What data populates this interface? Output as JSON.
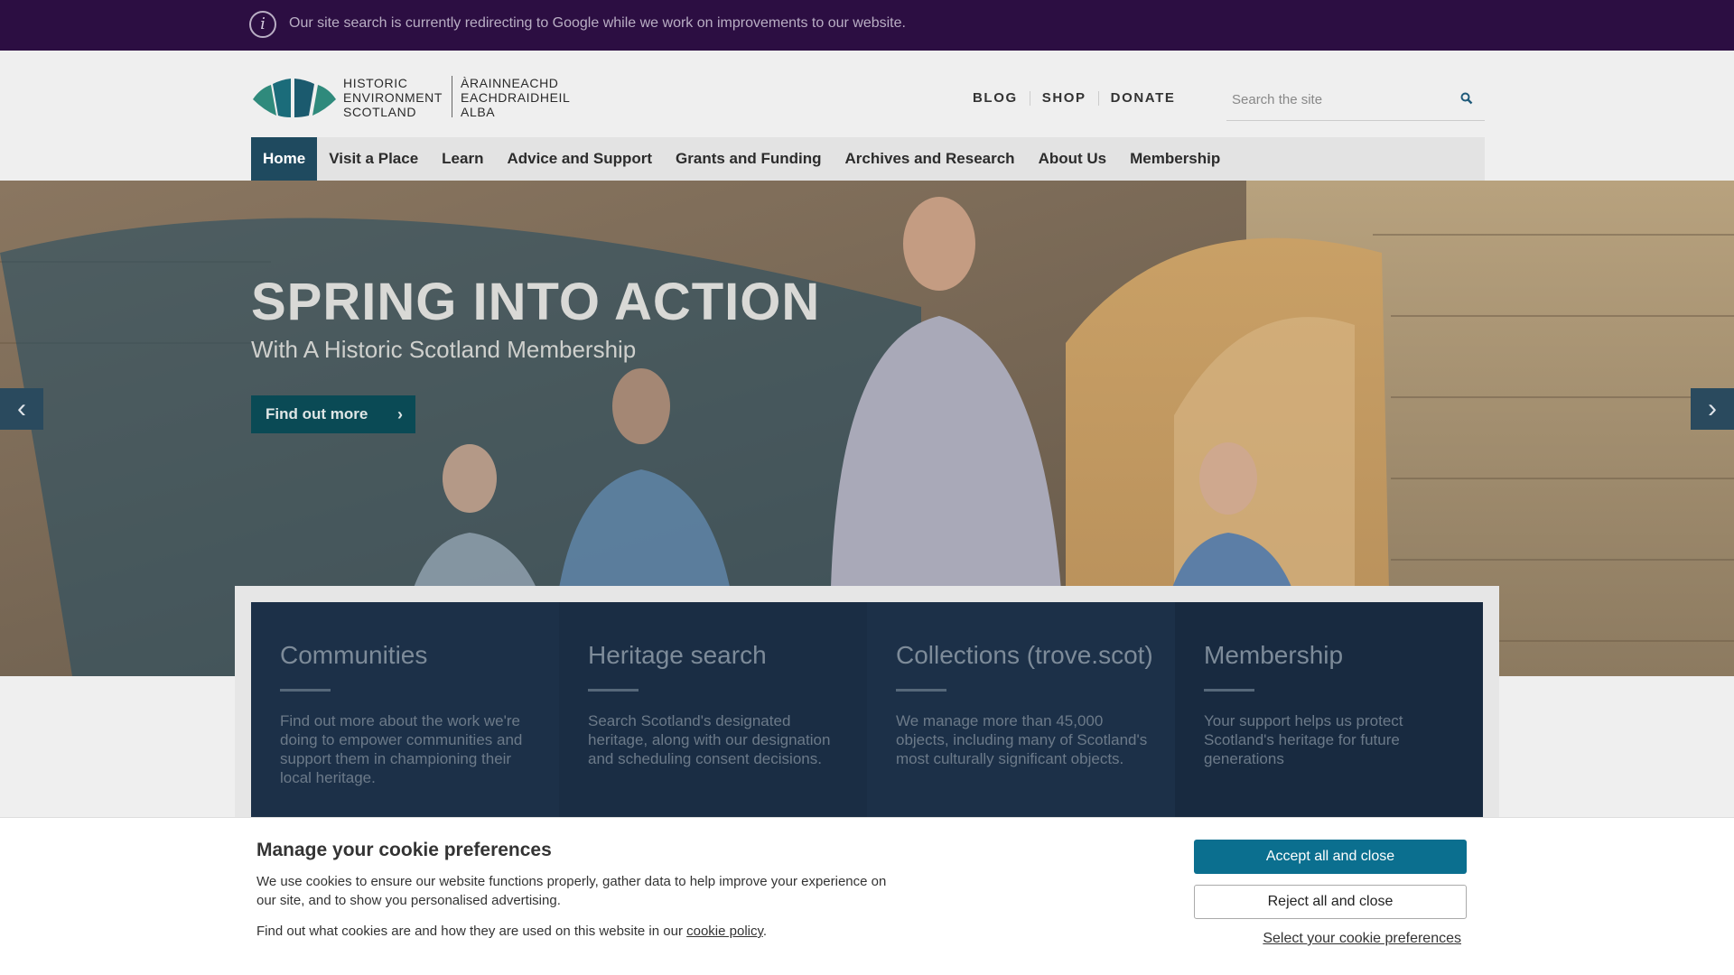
{
  "alert": {
    "icon": "info-icon",
    "text": "Our site search is currently redirecting to Google while we work on improvements to our website."
  },
  "logo": {
    "en": [
      "HISTORIC",
      "ENVIRONMENT",
      "SCOTLAND"
    ],
    "gd": [
      "ÀRAINNEACHD",
      "EACHDRAIDHEIL",
      "ALBA"
    ]
  },
  "utility_nav": [
    "BLOG",
    "SHOP",
    "DONATE"
  ],
  "search": {
    "placeholder": "Search the site",
    "icon": "search-icon"
  },
  "main_nav": [
    {
      "label": "Home",
      "active": true
    },
    {
      "label": "Visit a Place",
      "active": false
    },
    {
      "label": "Learn",
      "active": false
    },
    {
      "label": "Advice and Support",
      "active": false
    },
    {
      "label": "Grants and Funding",
      "active": false
    },
    {
      "label": "Archives and Research",
      "active": false
    },
    {
      "label": "About Us",
      "active": false
    },
    {
      "label": "Membership",
      "active": false
    }
  ],
  "hero": {
    "title": "SPRING INTO ACTION",
    "subtitle": "With A Historic Scotland Membership",
    "button": "Find out more",
    "prev_icon": "chevron-left-icon",
    "next_icon": "chevron-right-icon"
  },
  "cards": [
    {
      "title": "Communities",
      "text": "Find out more about the work we're doing to empower communities and support them in championing their local heritage."
    },
    {
      "title": "Heritage search",
      "text": "Search Scotland's designated heritage, along with our designation and scheduling consent decisions."
    },
    {
      "title": "Collections (trove.scot)",
      "text": "We manage more than 45,000 objects, including many of Scotland's most culturally significant objects."
    },
    {
      "title": "Membership",
      "text": "Your support helps us protect Scotland's heritage for future generations"
    }
  ],
  "cookie": {
    "title": "Manage your cookie preferences",
    "text": "We use cookies to ensure our website functions properly, gather data to help improve your experience on our site, and to show you personalised advertising.",
    "text2_before": "Find out what cookies are and how they are used on this website in our ",
    "link": "cookie policy",
    "text2_after": ".",
    "accept": "Accept all and close",
    "reject": "Reject all and close",
    "preferences": "Select your cookie preferences"
  },
  "colors": {
    "alert_bg": "#2c0e42",
    "nav_active": "#1f4a5f",
    "card_bg": "#1c3048",
    "accept_button": "#0b6f8f"
  }
}
